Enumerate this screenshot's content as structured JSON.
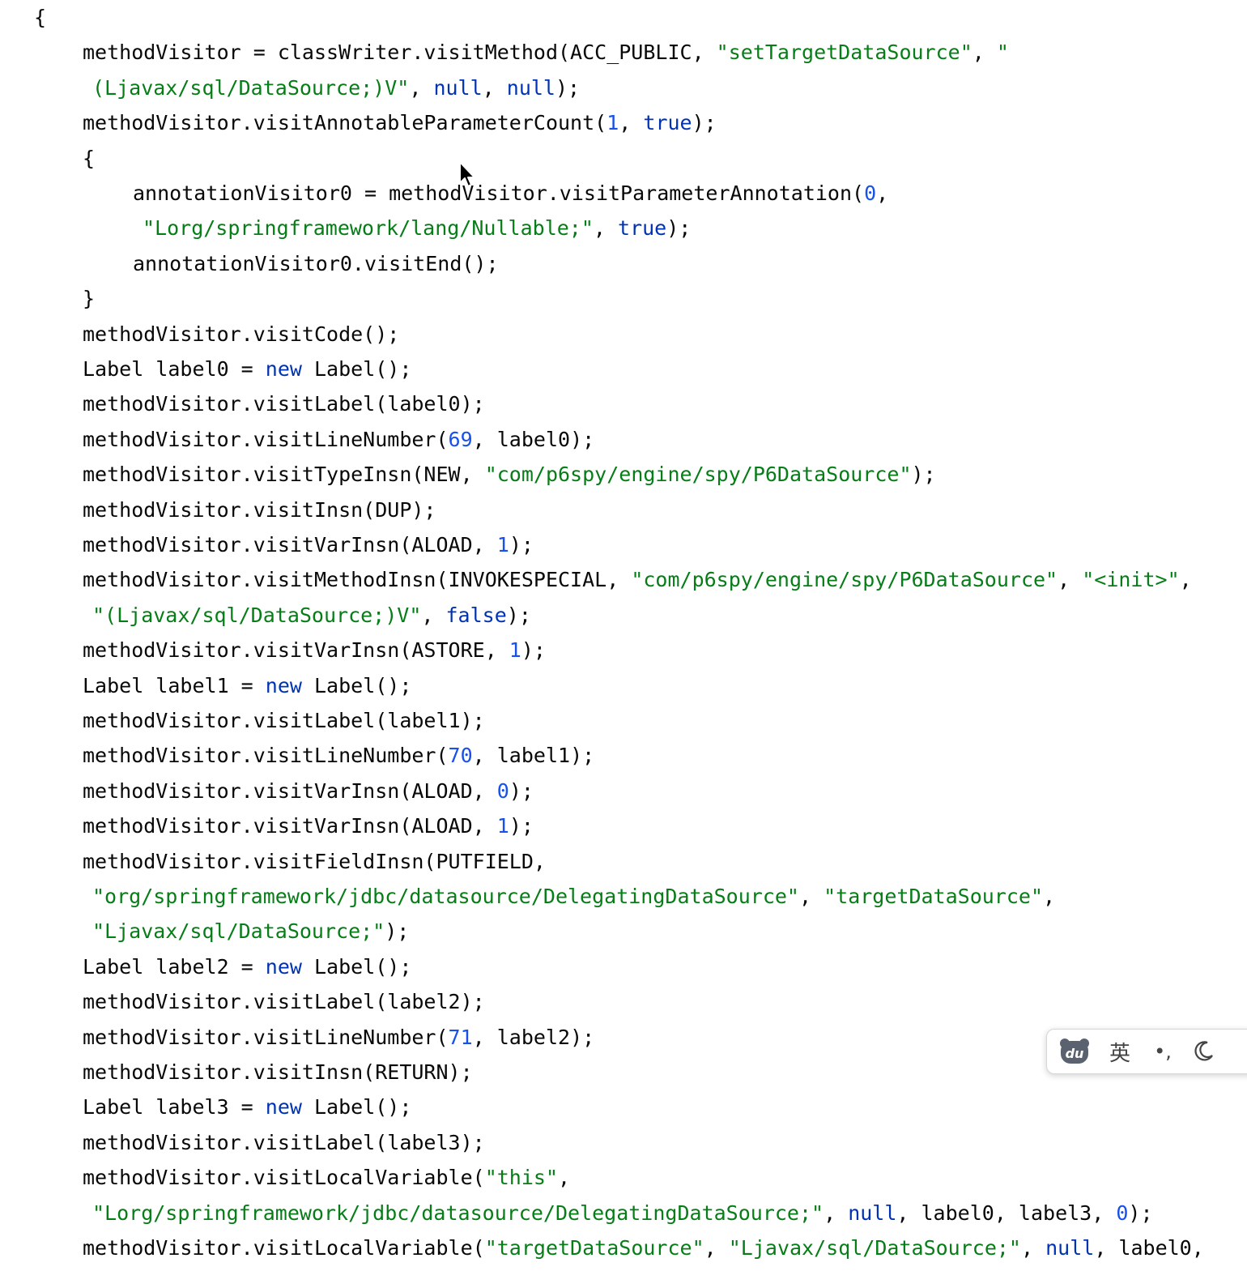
{
  "editor": {
    "language": "java",
    "colors": {
      "plain": "#080808",
      "string": "#067d17",
      "keyword": "#0033b3",
      "number": "#1750eb"
    },
    "lines": [
      {
        "tokens": [
          {
            "t": "plain",
            "v": "{"
          }
        ]
      },
      {
        "tokens": [
          {
            "t": "plain",
            "v": "methodVisitor = classWriter.visitMethod(ACC_PUBLIC, "
          },
          {
            "t": "string",
            "v": "\"setTargetDataSource\""
          },
          {
            "t": "plain",
            "v": ", "
          },
          {
            "t": "string",
            "v": "\""
          }
        ]
      },
      {
        "tokens": [
          {
            "t": "string",
            "v": "(Ljavax/sql/DataSource;)V\""
          },
          {
            "t": "plain",
            "v": ", "
          },
          {
            "t": "keyword",
            "v": "null"
          },
          {
            "t": "plain",
            "v": ", "
          },
          {
            "t": "keyword",
            "v": "null"
          },
          {
            "t": "plain",
            "v": ");"
          }
        ]
      },
      {
        "tokens": [
          {
            "t": "plain",
            "v": "methodVisitor.visitAnnotableParameterCount("
          },
          {
            "t": "number",
            "v": "1"
          },
          {
            "t": "plain",
            "v": ", "
          },
          {
            "t": "keyword",
            "v": "true"
          },
          {
            "t": "plain",
            "v": ");"
          }
        ]
      },
      {
        "tokens": [
          {
            "t": "plain",
            "v": "{"
          }
        ]
      },
      {
        "tokens": [
          {
            "t": "plain",
            "v": "annotationVisitor0 = methodVisitor.visitParameterAnnotation("
          },
          {
            "t": "number",
            "v": "0"
          },
          {
            "t": "plain",
            "v": ","
          }
        ]
      },
      {
        "tokens": [
          {
            "t": "string",
            "v": "\"Lorg/springframework/lang/Nullable;\""
          },
          {
            "t": "plain",
            "v": ", "
          },
          {
            "t": "keyword",
            "v": "true"
          },
          {
            "t": "plain",
            "v": ");"
          }
        ]
      },
      {
        "tokens": [
          {
            "t": "plain",
            "v": "annotationVisitor0.visitEnd();"
          }
        ]
      },
      {
        "tokens": [
          {
            "t": "plain",
            "v": "}"
          }
        ]
      },
      {
        "tokens": [
          {
            "t": "plain",
            "v": "methodVisitor.visitCode();"
          }
        ]
      },
      {
        "tokens": [
          {
            "t": "plain",
            "v": "Label label0 = "
          },
          {
            "t": "keyword",
            "v": "new"
          },
          {
            "t": "plain",
            "v": " Label();"
          }
        ]
      },
      {
        "tokens": [
          {
            "t": "plain",
            "v": "methodVisitor.visitLabel(label0);"
          }
        ]
      },
      {
        "tokens": [
          {
            "t": "plain",
            "v": "methodVisitor.visitLineNumber("
          },
          {
            "t": "number",
            "v": "69"
          },
          {
            "t": "plain",
            "v": ", label0);"
          }
        ]
      },
      {
        "tokens": [
          {
            "t": "plain",
            "v": "methodVisitor.visitTypeInsn(NEW, "
          },
          {
            "t": "string",
            "v": "\"com/p6spy/engine/spy/P6DataSource\""
          },
          {
            "t": "plain",
            "v": ");"
          }
        ]
      },
      {
        "tokens": [
          {
            "t": "plain",
            "v": "methodVisitor.visitInsn(DUP);"
          }
        ]
      },
      {
        "tokens": [
          {
            "t": "plain",
            "v": "methodVisitor.visitVarInsn(ALOAD, "
          },
          {
            "t": "number",
            "v": "1"
          },
          {
            "t": "plain",
            "v": ");"
          }
        ]
      },
      {
        "tokens": [
          {
            "t": "plain",
            "v": "methodVisitor.visitMethodInsn(INVOKESPECIAL, "
          },
          {
            "t": "string",
            "v": "\"com/p6spy/engine/spy/P6DataSource\""
          },
          {
            "t": "plain",
            "v": ", "
          },
          {
            "t": "string",
            "v": "\"<init>\""
          },
          {
            "t": "plain",
            "v": ","
          }
        ]
      },
      {
        "tokens": [
          {
            "t": "string",
            "v": "\"(Ljavax/sql/DataSource;)V\""
          },
          {
            "t": "plain",
            "v": ", "
          },
          {
            "t": "keyword",
            "v": "false"
          },
          {
            "t": "plain",
            "v": ");"
          }
        ]
      },
      {
        "tokens": [
          {
            "t": "plain",
            "v": "methodVisitor.visitVarInsn(ASTORE, "
          },
          {
            "t": "number",
            "v": "1"
          },
          {
            "t": "plain",
            "v": ");"
          }
        ]
      },
      {
        "tokens": [
          {
            "t": "plain",
            "v": "Label label1 = "
          },
          {
            "t": "keyword",
            "v": "new"
          },
          {
            "t": "plain",
            "v": " Label();"
          }
        ]
      },
      {
        "tokens": [
          {
            "t": "plain",
            "v": "methodVisitor.visitLabel(label1);"
          }
        ]
      },
      {
        "tokens": [
          {
            "t": "plain",
            "v": "methodVisitor.visitLineNumber("
          },
          {
            "t": "number",
            "v": "70"
          },
          {
            "t": "plain",
            "v": ", label1);"
          }
        ]
      },
      {
        "tokens": [
          {
            "t": "plain",
            "v": "methodVisitor.visitVarInsn(ALOAD, "
          },
          {
            "t": "number",
            "v": "0"
          },
          {
            "t": "plain",
            "v": ");"
          }
        ]
      },
      {
        "tokens": [
          {
            "t": "plain",
            "v": "methodVisitor.visitVarInsn(ALOAD, "
          },
          {
            "t": "number",
            "v": "1"
          },
          {
            "t": "plain",
            "v": ");"
          }
        ]
      },
      {
        "tokens": [
          {
            "t": "plain",
            "v": "methodVisitor.visitFieldInsn(PUTFIELD,"
          }
        ]
      },
      {
        "tokens": [
          {
            "t": "string",
            "v": "\"org/springframework/jdbc/datasource/DelegatingDataSource\""
          },
          {
            "t": "plain",
            "v": ", "
          },
          {
            "t": "string",
            "v": "\"targetDataSource\""
          },
          {
            "t": "plain",
            "v": ","
          }
        ]
      },
      {
        "tokens": [
          {
            "t": "string",
            "v": "\"Ljavax/sql/DataSource;\""
          },
          {
            "t": "plain",
            "v": ");"
          }
        ]
      },
      {
        "tokens": [
          {
            "t": "plain",
            "v": "Label label2 = "
          },
          {
            "t": "keyword",
            "v": "new"
          },
          {
            "t": "plain",
            "v": " Label();"
          }
        ]
      },
      {
        "tokens": [
          {
            "t": "plain",
            "v": "methodVisitor.visitLabel(label2);"
          }
        ]
      },
      {
        "tokens": [
          {
            "t": "plain",
            "v": "methodVisitor.visitLineNumber("
          },
          {
            "t": "number",
            "v": "71"
          },
          {
            "t": "plain",
            "v": ", label2);"
          }
        ]
      },
      {
        "tokens": [
          {
            "t": "plain",
            "v": "methodVisitor.visitInsn(RETURN);"
          }
        ]
      },
      {
        "tokens": [
          {
            "t": "plain",
            "v": "Label label3 = "
          },
          {
            "t": "keyword",
            "v": "new"
          },
          {
            "t": "plain",
            "v": " Label();"
          }
        ]
      },
      {
        "tokens": [
          {
            "t": "plain",
            "v": "methodVisitor.visitLabel(label3);"
          }
        ]
      },
      {
        "tokens": [
          {
            "t": "plain",
            "v": "methodVisitor.visitLocalVariable("
          },
          {
            "t": "string",
            "v": "\"this\""
          },
          {
            "t": "plain",
            "v": ","
          }
        ]
      },
      {
        "tokens": [
          {
            "t": "string",
            "v": "\"Lorg/springframework/jdbc/datasource/DelegatingDataSource;\""
          },
          {
            "t": "plain",
            "v": ", "
          },
          {
            "t": "keyword",
            "v": "null"
          },
          {
            "t": "plain",
            "v": ", label0, label3, "
          },
          {
            "t": "number",
            "v": "0"
          },
          {
            "t": "plain",
            "v": ");"
          }
        ]
      },
      {
        "tokens": [
          {
            "t": "plain",
            "v": "methodVisitor.visitLocalVariable("
          },
          {
            "t": "string",
            "v": "\"targetDataSource\""
          },
          {
            "t": "plain",
            "v": ", "
          },
          {
            "t": "string",
            "v": "\"Ljavax/sql/DataSource;\""
          },
          {
            "t": "plain",
            "v": ", "
          },
          {
            "t": "keyword",
            "v": "null"
          },
          {
            "t": "plain",
            "v": ", label0,"
          }
        ]
      }
    ]
  },
  "ime_toolbar": {
    "logo_icon": "baidu-paw-icon",
    "logo_text": "du",
    "language_label": "英",
    "punctuation_label": "•,",
    "theme_icon": "moon-icon",
    "logo_color": "#5a6270"
  },
  "cursor": {
    "icon": "mouse-pointer-icon"
  }
}
